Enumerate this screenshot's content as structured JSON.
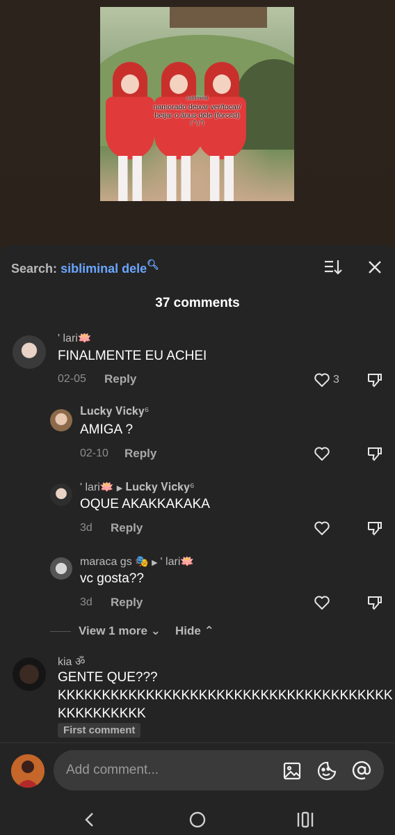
{
  "video": {
    "overlay_small": "subliminal",
    "overlay_line1": "namorado deixar ver/tocar/",
    "overlay_line2": "beijar o ânus dele (forced)",
    "overlay_line3": "( ͡° ͜ʖ ͡°)"
  },
  "header": {
    "search_label": "Search:",
    "search_term": "sibliminal dele",
    "comment_count": "37 comments"
  },
  "comments": [
    {
      "user": "' lari🪷",
      "text": "FINALMENTE EU ACHEI",
      "date": "02-05",
      "reply": "Reply",
      "likes": "3"
    },
    {
      "user": "𝐋𝐮𝐜𝐤𝐲 𝐕𝐢𝐜𝐤𝐲⁶",
      "text": "AMIGA ?",
      "date": "02-10",
      "reply": "Reply"
    },
    {
      "user": "' lari🪷",
      "reply_to": "𝐋𝐮𝐜𝐤𝐲 𝐕𝐢𝐜𝐤𝐲⁶",
      "text": "OQUE AKAKKAKAKA",
      "date": "3d",
      "reply": "Reply"
    },
    {
      "user": "maraca gs 🎭",
      "reply_to": "' lari🪷",
      "text": "vc gosta??",
      "date": "3d",
      "reply": "Reply"
    },
    {
      "user": "kia ॐ",
      "text_line1": "GENTE QUE???",
      "text_line2": "KKKKKKKKKKKKKKKKKKKKKKKKKKKKKKKKKKKKKK",
      "text_line3": "KKKKKKKKKK",
      "badge": "First comment"
    }
  ],
  "thread": {
    "view_more": "View 1 more",
    "hide": "Hide"
  },
  "input": {
    "placeholder": "Add comment..."
  },
  "colors": {
    "accent": "#6aa6ff",
    "sheet_bg": "#242424",
    "input_bg": "#3a3a3a"
  }
}
